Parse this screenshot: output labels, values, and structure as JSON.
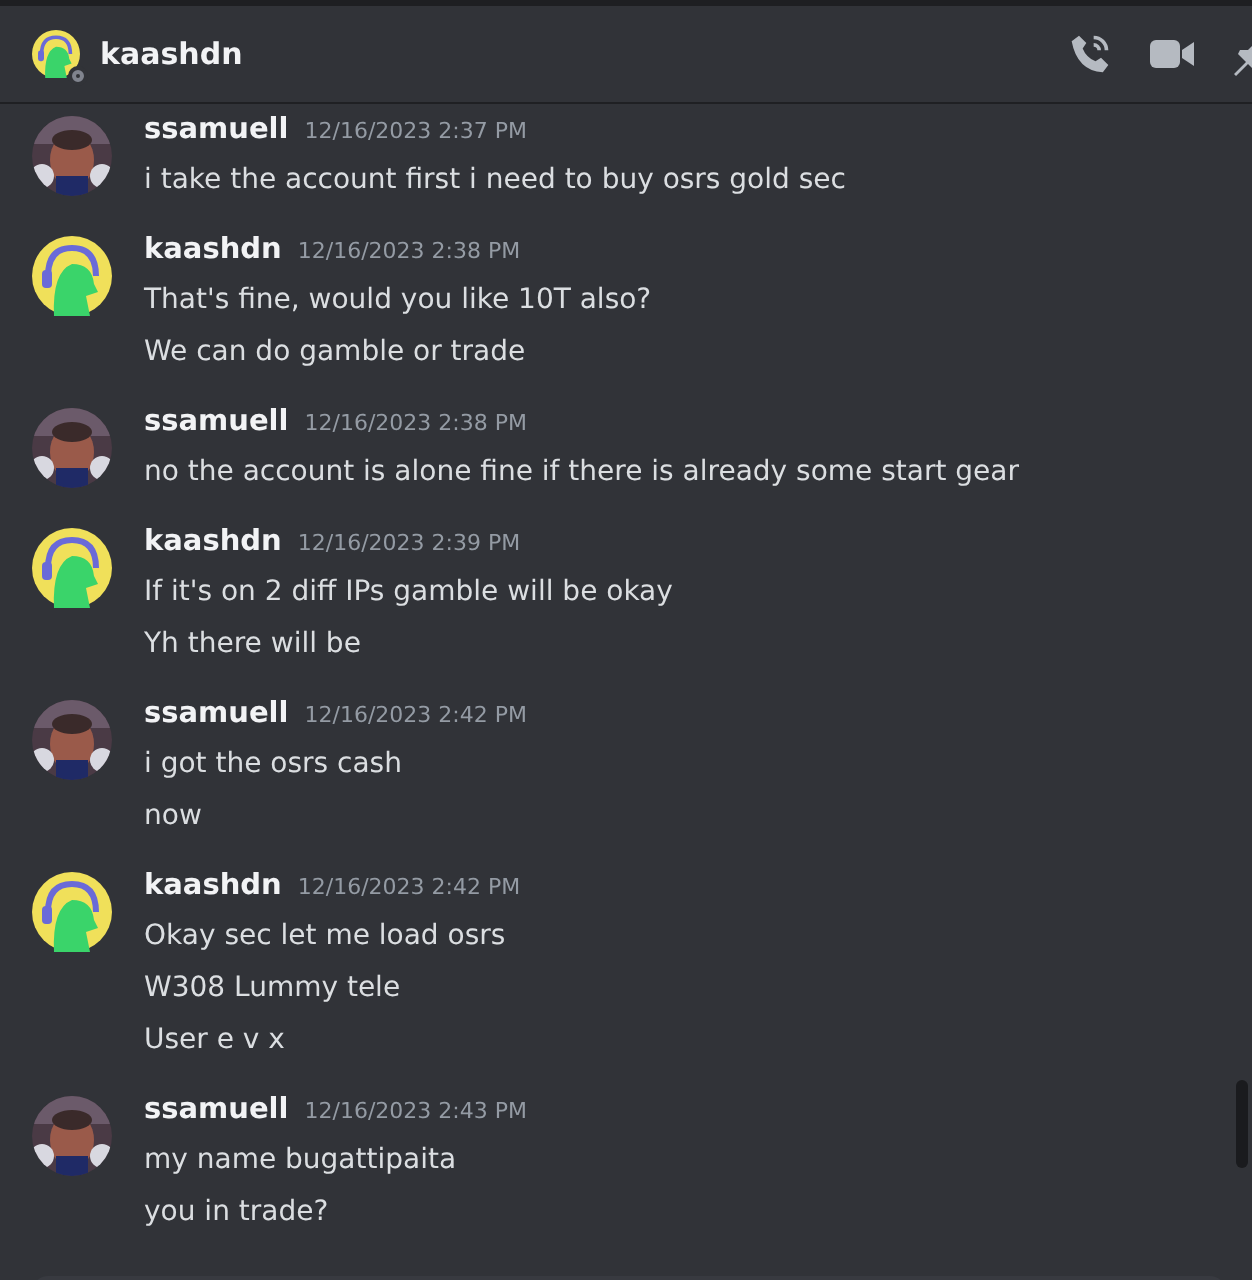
{
  "header": {
    "name": "kaashdn",
    "online": false
  },
  "messages": [
    {
      "author": "ssamuell",
      "time": "12/16/2023 2:37 PM",
      "lines": [
        "i take the account first i need to buy osrs gold sec"
      ]
    },
    {
      "author": "kaashdn",
      "kind": "cartoon",
      "time": "12/16/2023 2:38 PM",
      "lines": [
        "That's fine, would you like 10T also?",
        "We can do gamble or trade"
      ]
    },
    {
      "author": "ssamuell",
      "time": "12/16/2023 2:38 PM",
      "lines": [
        "no the account is alone fine if there is already some start gear"
      ]
    },
    {
      "author": "kaashdn",
      "kind": "cartoon",
      "time": "12/16/2023 2:39 PM",
      "lines": [
        "If it's on 2 diff IPs gamble will be okay",
        "Yh there will be"
      ]
    },
    {
      "author": "ssamuell",
      "time": "12/16/2023 2:42 PM",
      "lines": [
        "i got the osrs cash",
        "now"
      ]
    },
    {
      "author": "kaashdn",
      "kind": "cartoon",
      "time": "12/16/2023 2:42 PM",
      "lines": [
        "Okay sec let me load osrs",
        "W308 Lummy tele",
        "User e v x"
      ]
    },
    {
      "author": "ssamuell",
      "time": "12/16/2023 2:43 PM",
      "lines": [
        "my name bugattipaita",
        "you in trade?"
      ]
    }
  ]
}
